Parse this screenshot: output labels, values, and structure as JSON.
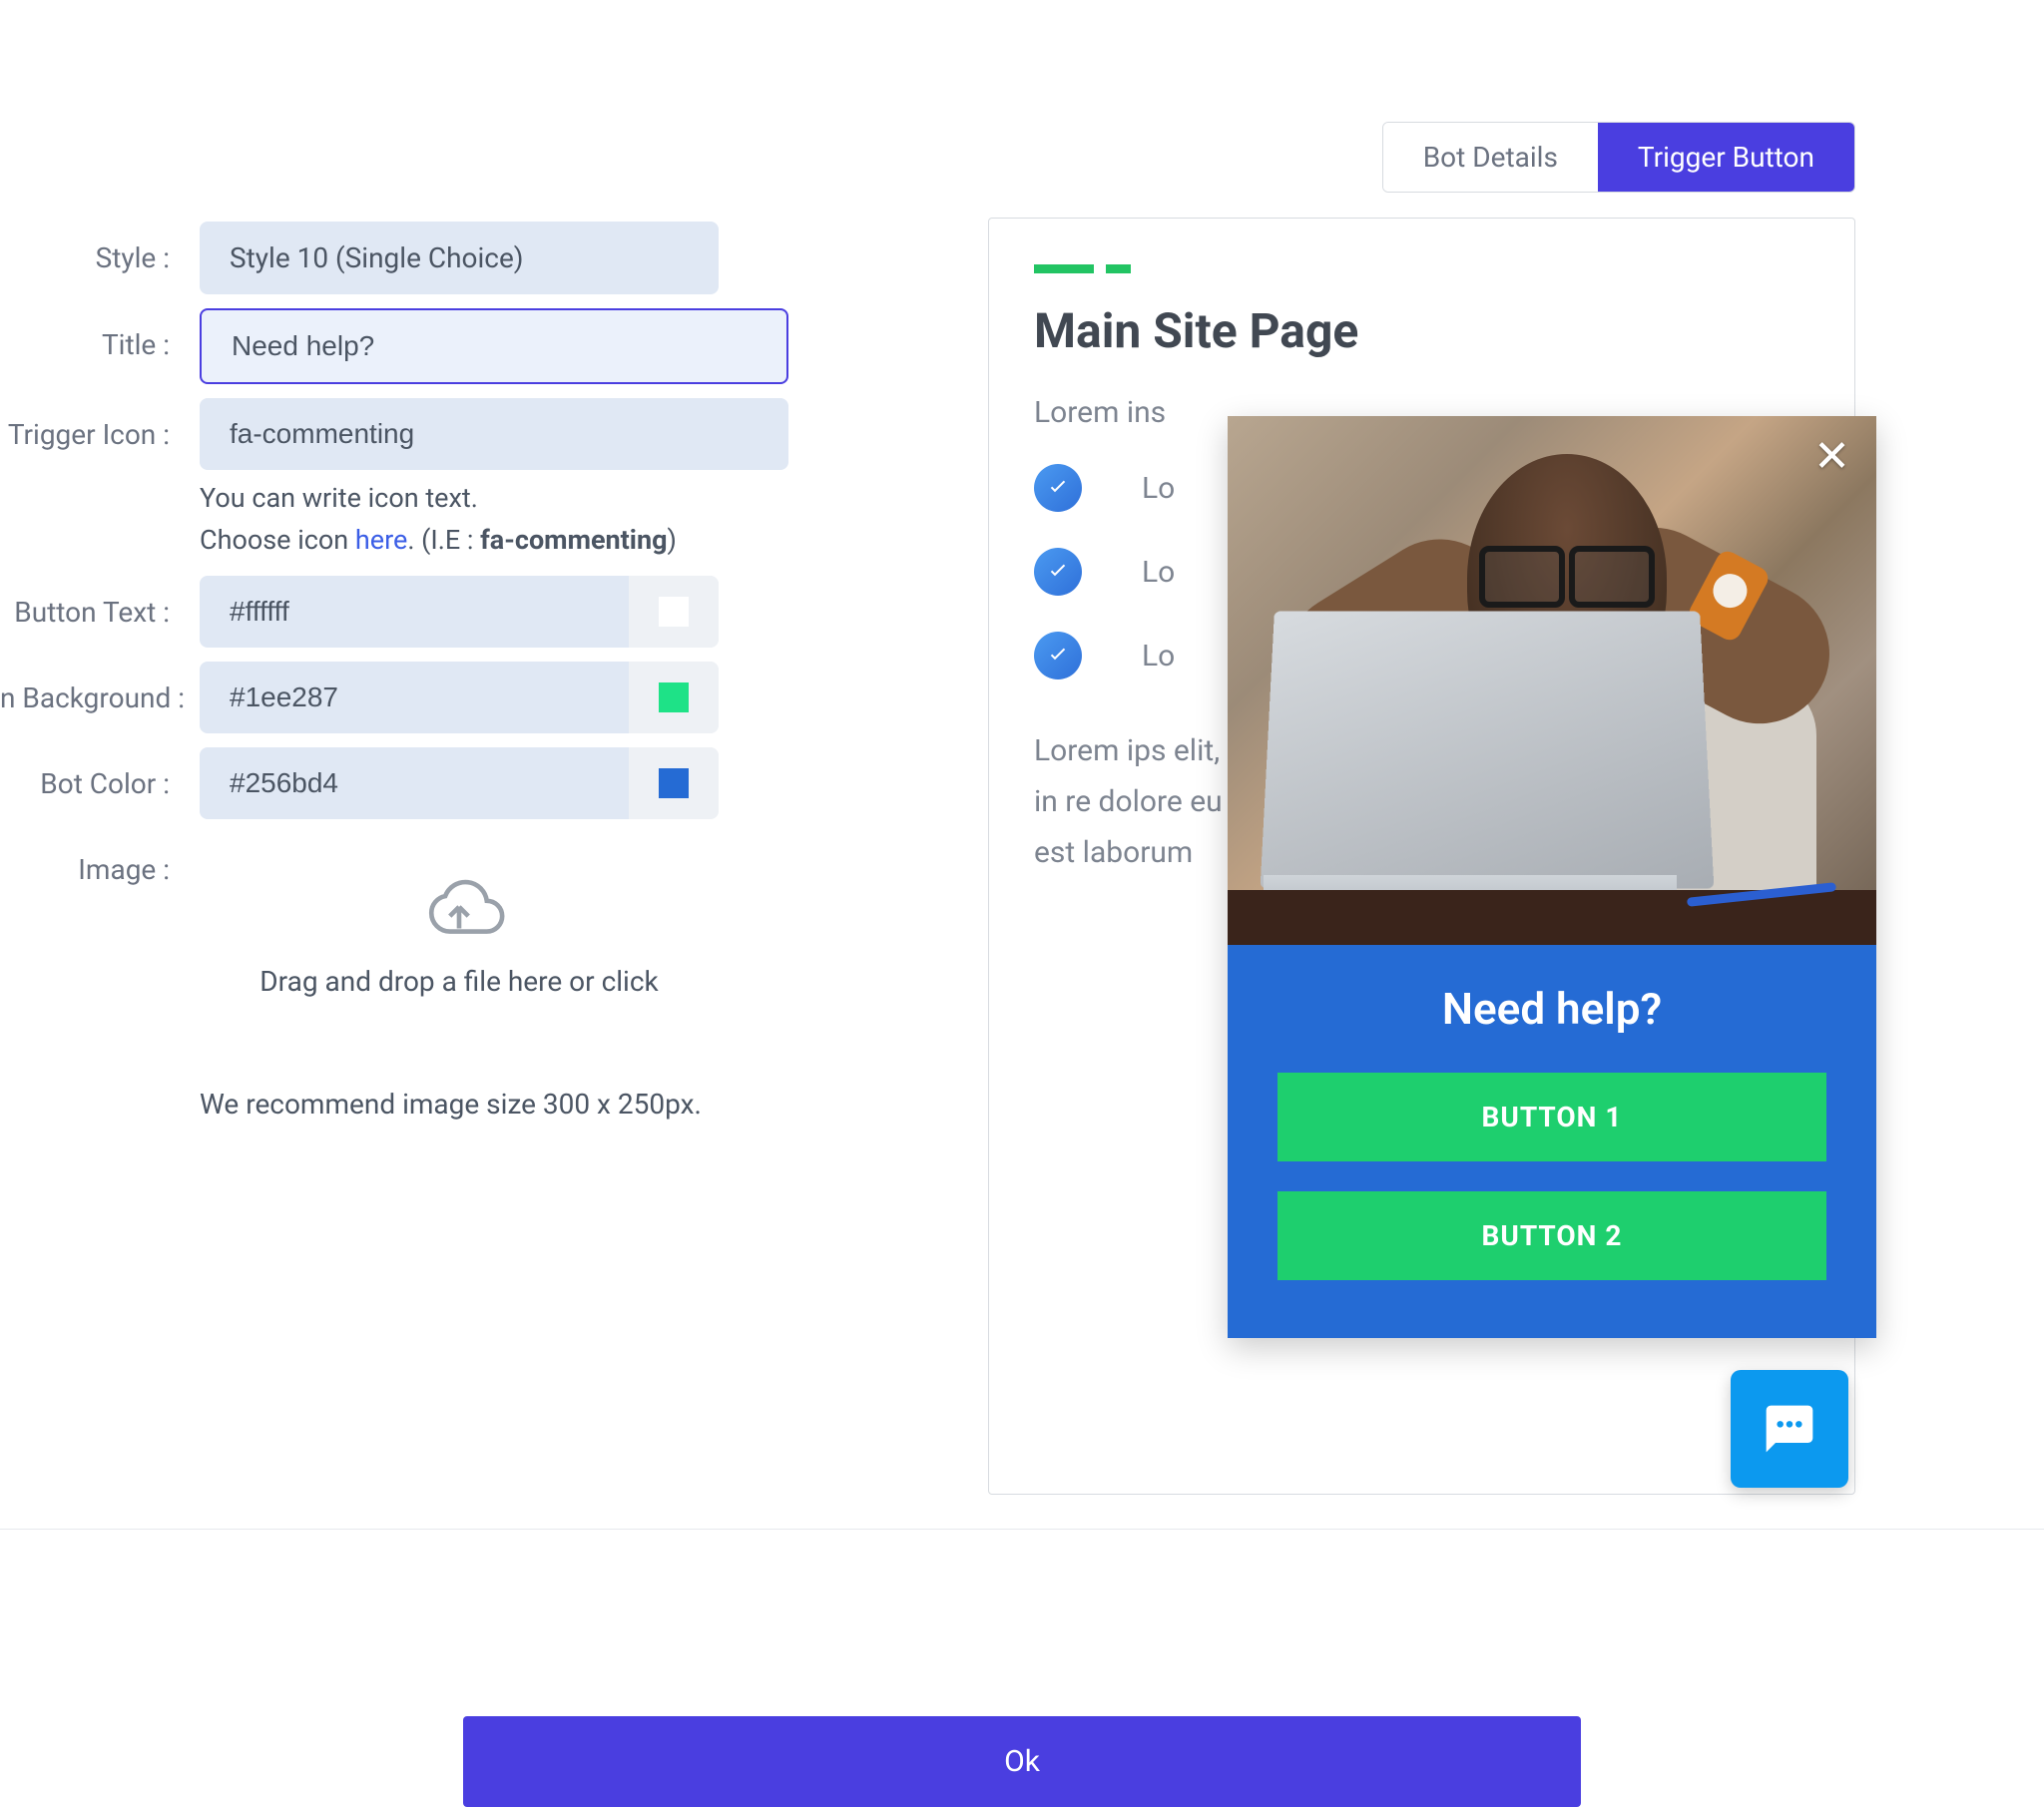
{
  "tabs": {
    "details": "Bot Details",
    "trigger": "Trigger Button"
  },
  "form": {
    "style_label": "Style :",
    "style_value": "Style 10 (Single Choice)",
    "title_label": "Title :",
    "title_value": "Need help?",
    "trigger_icon_label": "Trigger Icon :",
    "trigger_icon_value": "fa-commenting",
    "helper_line1": "You can write icon text.",
    "helper_line2_prefix": "Choose icon ",
    "helper_link": "here",
    "helper_line2_mid": ". (I.E : ",
    "helper_example": "fa-commenting",
    "helper_line2_suffix": ")",
    "button_text_label": "Button Text :",
    "button_text_value": "#ffffff",
    "button_text_swatch": "#ffffff",
    "button_bg_label": "n Background :",
    "button_bg_value": "#1ee287",
    "button_bg_swatch": "#1ee287",
    "bot_color_label": "Bot Color :",
    "bot_color_value": "#256bd4",
    "bot_color_swatch": "#256bd4",
    "image_label": "Image :",
    "drop_text": "Drag and drop a file here or click",
    "recommend": "We recommend image size 300 x 250px."
  },
  "preview": {
    "title": "Main Site Page",
    "lead": "Lorem ins",
    "items": [
      "Lo",
      "Lo",
      "Lo"
    ],
    "body": "Lorem ips elit, sed d dolore ma quis nostr aliquip ex dolor in re dolore eu occaecat c officia deserunt mollit anim id est laborum"
  },
  "popup": {
    "title": "Need help?",
    "button1": "BUTTON 1",
    "button2": "BUTTON 2"
  },
  "footer": {
    "ok": "Ok"
  }
}
